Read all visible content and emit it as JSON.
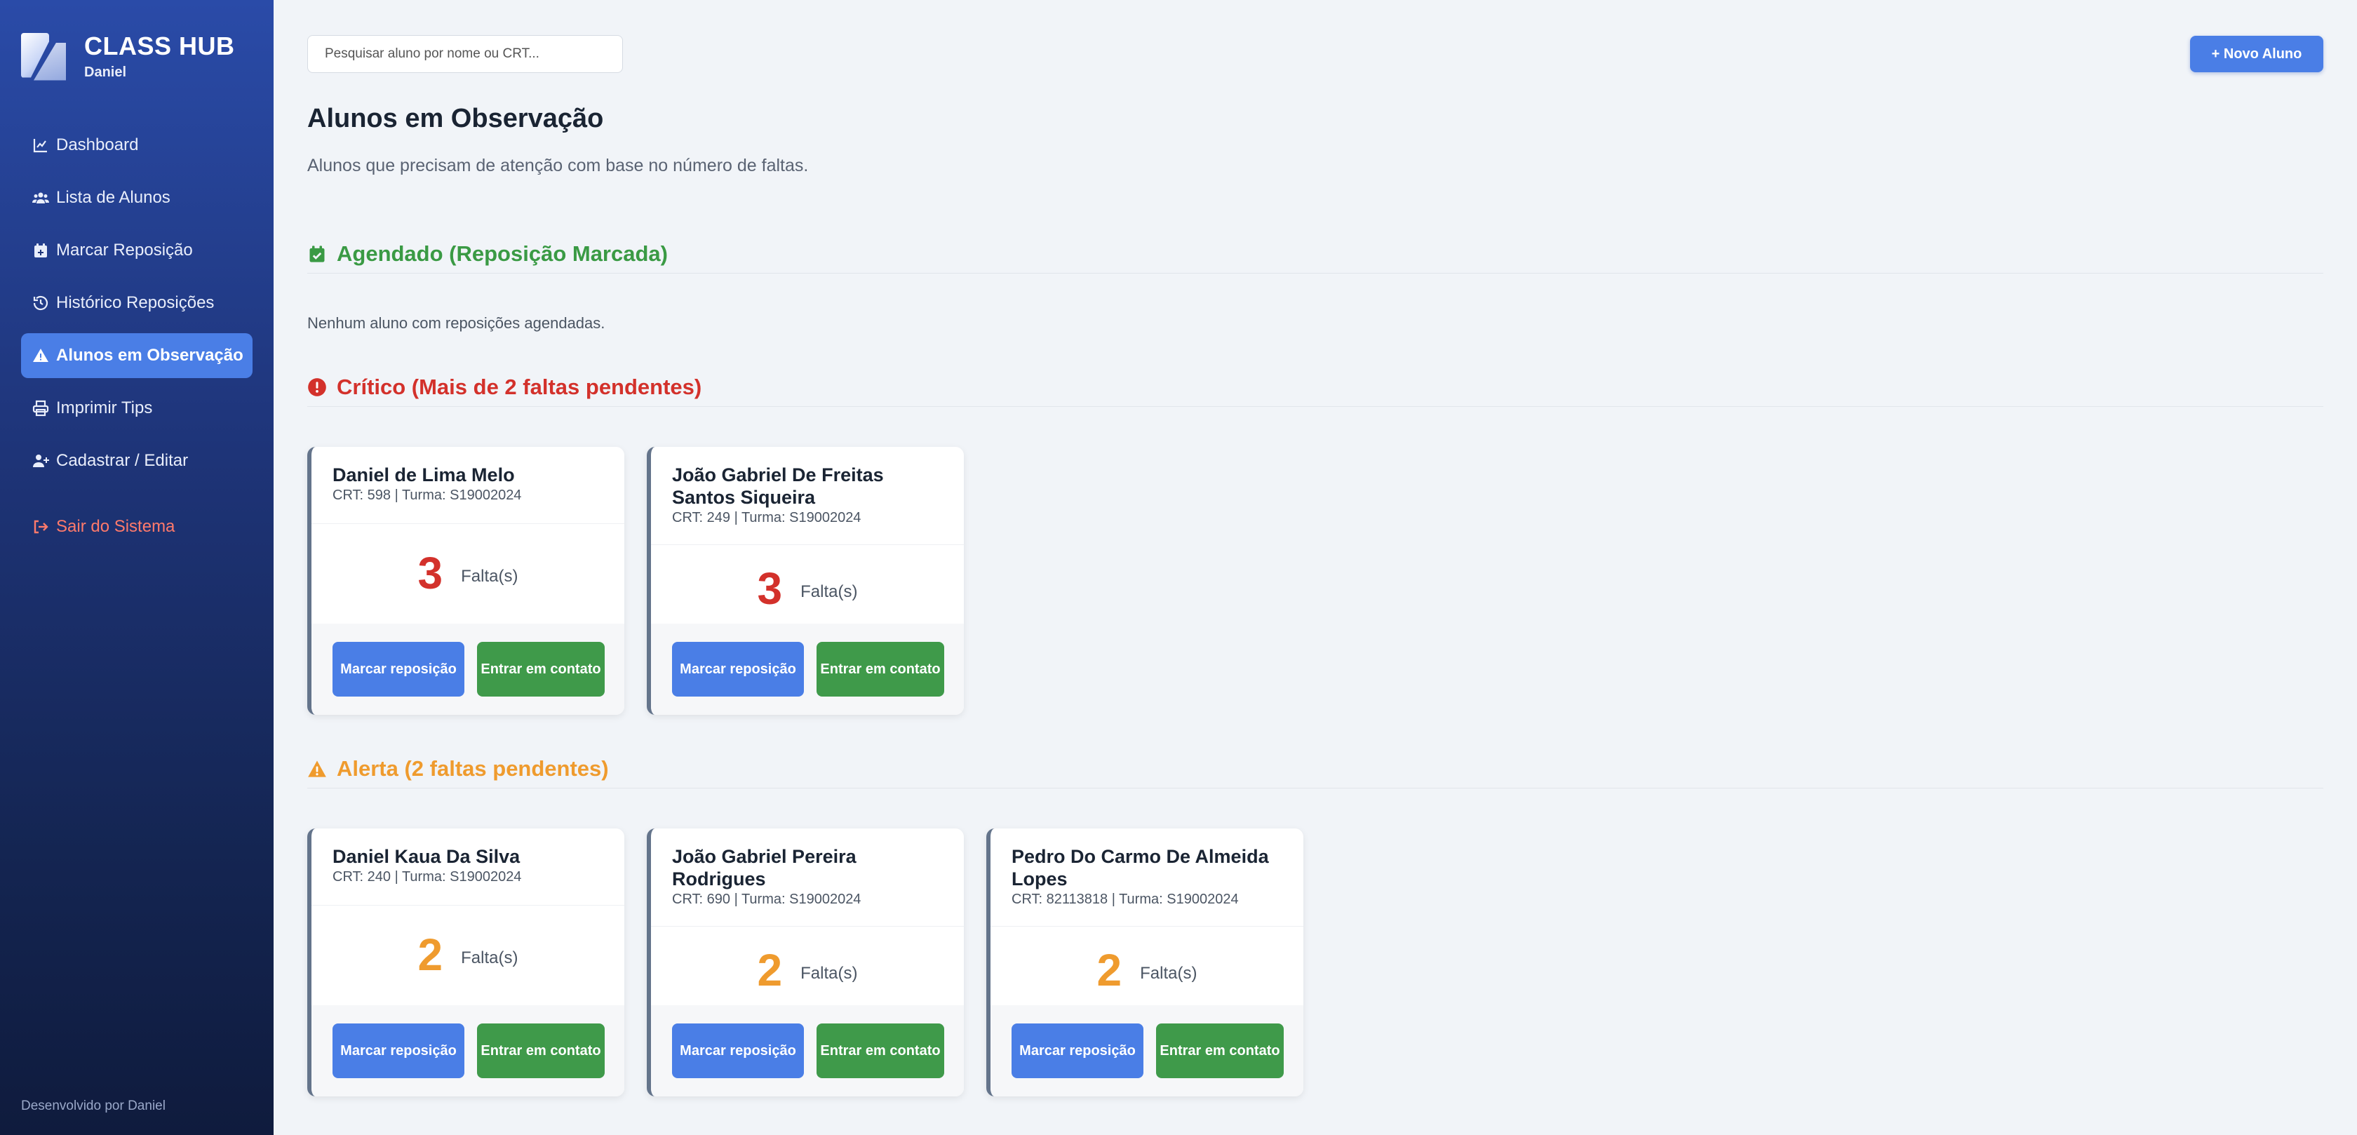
{
  "sidebar": {
    "brand_title": "CLASS HUB",
    "brand_user": "Daniel",
    "items": [
      {
        "label": "Dashboard",
        "icon": "chart-line-icon"
      },
      {
        "label": "Lista de Alunos",
        "icon": "users-icon"
      },
      {
        "label": "Marcar Reposição",
        "icon": "calendar-plus-icon"
      },
      {
        "label": "Histórico Reposições",
        "icon": "history-icon"
      },
      {
        "label": "Alunos em Observação",
        "icon": "warning-icon",
        "active": true
      },
      {
        "label": "Imprimir Tips",
        "icon": "printer-icon"
      },
      {
        "label": "Cadastrar / Editar",
        "icon": "user-plus-icon"
      }
    ],
    "logout_label": "Sair do Sistema",
    "footer": "Desenvolvido por Daniel"
  },
  "search": {
    "placeholder": "Pesquisar aluno por nome ou CRT..."
  },
  "header": {
    "new_button": "+ Novo Aluno"
  },
  "page": {
    "title": "Alunos em Observação",
    "subtitle": "Alunos que precisam de atenção com base no número de faltas."
  },
  "sections": {
    "scheduled": {
      "title": "Agendado (Reposição Marcada)",
      "empty": "Nenhum aluno com reposições agendadas.",
      "color": "#3a9a44"
    },
    "critical": {
      "title": "Crítico (Mais de 2 faltas pendentes)",
      "color": "#d3312b"
    },
    "alert": {
      "title": "Alerta (2 faltas pendentes)",
      "color": "#ef9b2e"
    }
  },
  "labels": {
    "faltas": "Falta(s)",
    "marcar": "Marcar reposição",
    "contato": "Entrar em contato"
  },
  "critical_students": [
    {
      "name": "Daniel de Lima Melo",
      "meta": "CRT: 598 | Turma: S19002024",
      "count": "3"
    },
    {
      "name": "João Gabriel De Freitas Santos Siqueira",
      "meta": "CRT: 249 | Turma: S19002024",
      "count": "3"
    }
  ],
  "alert_students": [
    {
      "name": "Daniel Kaua Da Silva",
      "meta": "CRT: 240 | Turma: S19002024",
      "count": "2"
    },
    {
      "name": "João Gabriel Pereira Rodrigues",
      "meta": "CRT: 690 | Turma: S19002024",
      "count": "2"
    },
    {
      "name": "Pedro Do Carmo De Almeida Lopes",
      "meta": "CRT: 82113818 | Turma: S19002024",
      "count": "2"
    }
  ]
}
